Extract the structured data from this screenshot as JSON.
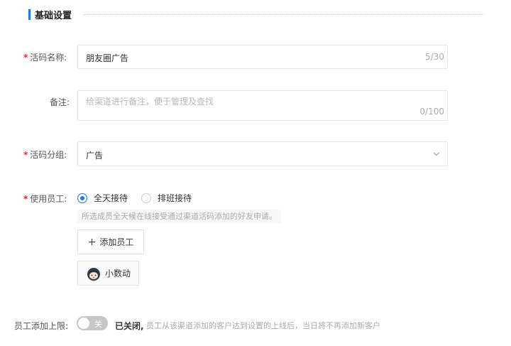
{
  "section": {
    "title": "基础设置"
  },
  "name_field": {
    "label": "活码名称:",
    "required_mark": "*",
    "value": "朋友圈广告",
    "counter": "5/30"
  },
  "remark_field": {
    "label": "备注:",
    "placeholder": "给渠道进行备注，便于管理及查找",
    "counter": "0/100"
  },
  "group_field": {
    "label": "活码分组:",
    "required_mark": "*",
    "value": "广告"
  },
  "staff_field": {
    "label": "使用员工:",
    "required_mark": "*",
    "options": [
      {
        "label": "全天接待",
        "selected": true
      },
      {
        "label": "排班接待",
        "selected": false
      }
    ],
    "tip": "所选成员全天候在线接受通过渠道活码添加的好友申请。",
    "add_button": "添加员工",
    "add_icon": "+",
    "staff": [
      {
        "name": "小数动"
      }
    ]
  },
  "limit_field": {
    "label": "员工添加上限:",
    "toggle_text": "关",
    "toggle_on": false,
    "status": "已关闭,",
    "description": "员工从该渠道添加的客户达到设置的上线后，当日将不再添加新客户"
  },
  "colors": {
    "accent": "#1677ff",
    "required": "#f5222d",
    "toggle_off": "#c7c7c7"
  }
}
